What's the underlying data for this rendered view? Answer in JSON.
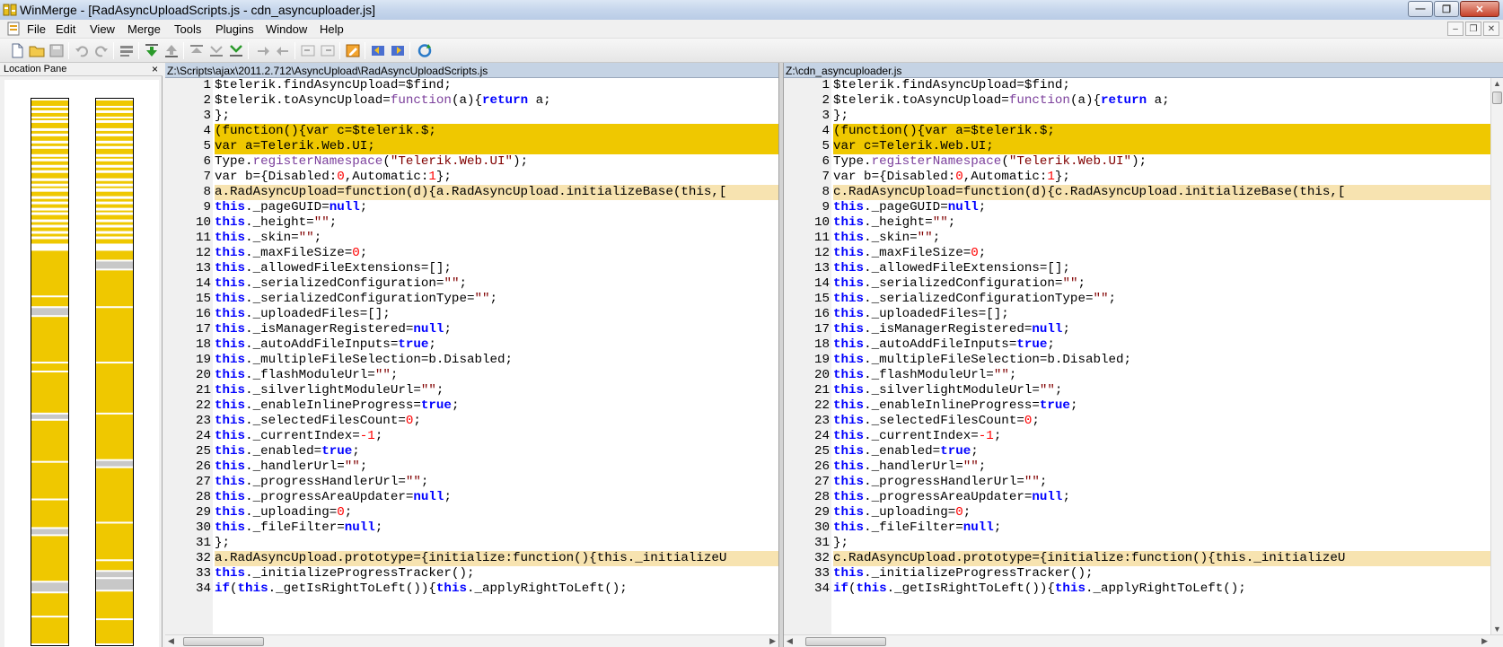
{
  "window": {
    "title": "WinMerge - [RadAsyncUploadScripts.js - cdn_asyncuploader.js]",
    "minimize_glyph": "—",
    "maximize_glyph": "❐",
    "close_glyph": "✕"
  },
  "menu": [
    "File",
    "Edit",
    "View",
    "Merge",
    "Tools",
    "Plugins",
    "Window",
    "Help"
  ],
  "mdi": {
    "minimize_glyph": "–",
    "restore_glyph": "❐",
    "close_glyph": "✕"
  },
  "location_pane": {
    "title": "Location Pane",
    "close_glyph": "×"
  },
  "left_pane": {
    "path": "Z:\\Scripts\\ajax\\2011.2.712\\AsyncUpload\\RadAsyncUploadScripts.js"
  },
  "right_pane": {
    "path": "Z:\\cdn_asyncuploader.js"
  },
  "colors": {
    "diff": "#efc800",
    "change": "#f7e3b0",
    "keyword": "#0000ff",
    "string": "#800000",
    "number": "#ff0000"
  },
  "left_lines": [
    {
      "n": "1",
      "t": "plain",
      "segs": [
        [
          "i",
          "$telerik.findAsyncUpload=$find;"
        ]
      ]
    },
    {
      "n": "2",
      "t": "plain",
      "segs": [
        [
          "i",
          "$telerik.toAsyncUpload="
        ],
        [
          "f",
          "function"
        ],
        [
          "i",
          "(a){"
        ],
        [
          "k",
          "return"
        ],
        [
          "i",
          " a;"
        ]
      ]
    },
    {
      "n": "3",
      "t": "plain",
      "segs": [
        [
          "i",
          "};"
        ]
      ]
    },
    {
      "n": "4",
      "t": "diff",
      "segs": [
        [
          "i",
          "(function(){var c=$telerik.$;"
        ]
      ]
    },
    {
      "n": "5",
      "t": "diff",
      "segs": [
        [
          "i",
          "var a=Telerik.Web.UI;"
        ]
      ]
    },
    {
      "n": "6",
      "t": "plain",
      "segs": [
        [
          "i",
          "Type."
        ],
        [
          "f",
          "registerNamespace"
        ],
        [
          "i",
          "("
        ],
        [
          "s",
          "\"Telerik.Web.UI\""
        ],
        [
          "i",
          ");"
        ]
      ]
    },
    {
      "n": "7",
      "t": "plain",
      "segs": [
        [
          "i",
          "var b={Disabled:"
        ],
        [
          "n",
          "0"
        ],
        [
          "i",
          ",Automatic:"
        ],
        [
          "n",
          "1"
        ],
        [
          "i",
          "};"
        ]
      ]
    },
    {
      "n": "8",
      "t": "change",
      "segs": [
        [
          "i",
          "a.RadAsyncUpload=function(d){a.RadAsyncUpload.initializeBase(this,["
        ]
      ]
    },
    {
      "n": "9",
      "t": "plain",
      "segs": [
        [
          "k",
          "this"
        ],
        [
          "i",
          "._pageGUID="
        ],
        [
          "k",
          "null"
        ],
        [
          "i",
          ";"
        ]
      ]
    },
    {
      "n": "10",
      "t": "plain",
      "segs": [
        [
          "k",
          "this"
        ],
        [
          "i",
          "._height="
        ],
        [
          "s",
          "\"\""
        ],
        [
          "i",
          ";"
        ]
      ]
    },
    {
      "n": "11",
      "t": "plain",
      "segs": [
        [
          "k",
          "this"
        ],
        [
          "i",
          "._skin="
        ],
        [
          "s",
          "\"\""
        ],
        [
          "i",
          ";"
        ]
      ]
    },
    {
      "n": "12",
      "t": "plain",
      "segs": [
        [
          "k",
          "this"
        ],
        [
          "i",
          "._maxFileSize="
        ],
        [
          "n",
          "0"
        ],
        [
          "i",
          ";"
        ]
      ]
    },
    {
      "n": "13",
      "t": "plain",
      "segs": [
        [
          "k",
          "this"
        ],
        [
          "i",
          "._allowedFileExtensions=[];"
        ]
      ]
    },
    {
      "n": "14",
      "t": "plain",
      "segs": [
        [
          "k",
          "this"
        ],
        [
          "i",
          "._serializedConfiguration="
        ],
        [
          "s",
          "\"\""
        ],
        [
          "i",
          ";"
        ]
      ]
    },
    {
      "n": "15",
      "t": "plain",
      "segs": [
        [
          "k",
          "this"
        ],
        [
          "i",
          "._serializedConfigurationType="
        ],
        [
          "s",
          "\"\""
        ],
        [
          "i",
          ";"
        ]
      ]
    },
    {
      "n": "16",
      "t": "plain",
      "segs": [
        [
          "k",
          "this"
        ],
        [
          "i",
          "._uploadedFiles=[];"
        ]
      ]
    },
    {
      "n": "17",
      "t": "plain",
      "segs": [
        [
          "k",
          "this"
        ],
        [
          "i",
          "._isManagerRegistered="
        ],
        [
          "k",
          "null"
        ],
        [
          "i",
          ";"
        ]
      ]
    },
    {
      "n": "18",
      "t": "plain",
      "segs": [
        [
          "k",
          "this"
        ],
        [
          "i",
          "._autoAddFileInputs="
        ],
        [
          "k",
          "true"
        ],
        [
          "i",
          ";"
        ]
      ]
    },
    {
      "n": "19",
      "t": "plain",
      "segs": [
        [
          "k",
          "this"
        ],
        [
          "i",
          "._multipleFileSelection=b.Disabled;"
        ]
      ]
    },
    {
      "n": "20",
      "t": "plain",
      "segs": [
        [
          "k",
          "this"
        ],
        [
          "i",
          "._flashModuleUrl="
        ],
        [
          "s",
          "\"\""
        ],
        [
          "i",
          ";"
        ]
      ]
    },
    {
      "n": "21",
      "t": "plain",
      "segs": [
        [
          "k",
          "this"
        ],
        [
          "i",
          "._silverlightModuleUrl="
        ],
        [
          "s",
          "\"\""
        ],
        [
          "i",
          ";"
        ]
      ]
    },
    {
      "n": "22",
      "t": "plain",
      "segs": [
        [
          "k",
          "this"
        ],
        [
          "i",
          "._enableInlineProgress="
        ],
        [
          "k",
          "true"
        ],
        [
          "i",
          ";"
        ]
      ]
    },
    {
      "n": "23",
      "t": "plain",
      "segs": [
        [
          "k",
          "this"
        ],
        [
          "i",
          "._selectedFilesCount="
        ],
        [
          "n",
          "0"
        ],
        [
          "i",
          ";"
        ]
      ]
    },
    {
      "n": "24",
      "t": "plain",
      "segs": [
        [
          "k",
          "this"
        ],
        [
          "i",
          "._currentIndex="
        ],
        [
          "n",
          "-1"
        ],
        [
          "i",
          ";"
        ]
      ]
    },
    {
      "n": "25",
      "t": "plain",
      "segs": [
        [
          "k",
          "this"
        ],
        [
          "i",
          "._enabled="
        ],
        [
          "k",
          "true"
        ],
        [
          "i",
          ";"
        ]
      ]
    },
    {
      "n": "26",
      "t": "plain",
      "segs": [
        [
          "k",
          "this"
        ],
        [
          "i",
          "._handlerUrl="
        ],
        [
          "s",
          "\"\""
        ],
        [
          "i",
          ";"
        ]
      ]
    },
    {
      "n": "27",
      "t": "plain",
      "segs": [
        [
          "k",
          "this"
        ],
        [
          "i",
          "._progressHandlerUrl="
        ],
        [
          "s",
          "\"\""
        ],
        [
          "i",
          ";"
        ]
      ]
    },
    {
      "n": "28",
      "t": "plain",
      "segs": [
        [
          "k",
          "this"
        ],
        [
          "i",
          "._progressAreaUpdater="
        ],
        [
          "k",
          "null"
        ],
        [
          "i",
          ";"
        ]
      ]
    },
    {
      "n": "29",
      "t": "plain",
      "segs": [
        [
          "k",
          "this"
        ],
        [
          "i",
          "._uploading="
        ],
        [
          "n",
          "0"
        ],
        [
          "i",
          ";"
        ]
      ]
    },
    {
      "n": "30",
      "t": "plain",
      "segs": [
        [
          "k",
          "this"
        ],
        [
          "i",
          "._fileFilter="
        ],
        [
          "k",
          "null"
        ],
        [
          "i",
          ";"
        ]
      ]
    },
    {
      "n": "31",
      "t": "plain",
      "segs": [
        [
          "i",
          "};"
        ]
      ]
    },
    {
      "n": "32",
      "t": "change",
      "segs": [
        [
          "i",
          "a.RadAsyncUpload.prototype={initialize:function(){this._initializeU"
        ]
      ]
    },
    {
      "n": "33",
      "t": "plain",
      "segs": [
        [
          "k",
          "this"
        ],
        [
          "i",
          "._initializeProgressTracker();"
        ]
      ]
    },
    {
      "n": "34",
      "t": "plain",
      "segs": [
        [
          "k",
          "if"
        ],
        [
          "i",
          "("
        ],
        [
          "k",
          "this"
        ],
        [
          "i",
          "._getIsRightToLeft()){"
        ],
        [
          "k",
          "this"
        ],
        [
          "i",
          "._applyRightToLeft();"
        ]
      ]
    }
  ],
  "right_lines": [
    {
      "n": "1",
      "t": "plain",
      "segs": [
        [
          "i",
          "$telerik.findAsyncUpload=$find;"
        ]
      ]
    },
    {
      "n": "2",
      "t": "plain",
      "segs": [
        [
          "i",
          "$telerik.toAsyncUpload="
        ],
        [
          "f",
          "function"
        ],
        [
          "i",
          "(a){"
        ],
        [
          "k",
          "return"
        ],
        [
          "i",
          " a;"
        ]
      ]
    },
    {
      "n": "3",
      "t": "plain",
      "segs": [
        [
          "i",
          "};"
        ]
      ]
    },
    {
      "n": "4",
      "t": "diff",
      "segs": [
        [
          "i",
          "(function(){var a=$telerik.$;"
        ]
      ]
    },
    {
      "n": "5",
      "t": "diff",
      "segs": [
        [
          "i",
          "var c=Telerik.Web.UI;"
        ]
      ]
    },
    {
      "n": "6",
      "t": "plain",
      "segs": [
        [
          "i",
          "Type."
        ],
        [
          "f",
          "registerNamespace"
        ],
        [
          "i",
          "("
        ],
        [
          "s",
          "\"Telerik.Web.UI\""
        ],
        [
          "i",
          ");"
        ]
      ]
    },
    {
      "n": "7",
      "t": "plain",
      "segs": [
        [
          "i",
          "var b={Disabled:"
        ],
        [
          "n",
          "0"
        ],
        [
          "i",
          ",Automatic:"
        ],
        [
          "n",
          "1"
        ],
        [
          "i",
          "};"
        ]
      ]
    },
    {
      "n": "8",
      "t": "change",
      "segs": [
        [
          "i",
          "c.RadAsyncUpload=function(d){c.RadAsyncUpload.initializeBase(this,["
        ]
      ]
    },
    {
      "n": "9",
      "t": "plain",
      "segs": [
        [
          "k",
          "this"
        ],
        [
          "i",
          "._pageGUID="
        ],
        [
          "k",
          "null"
        ],
        [
          "i",
          ";"
        ]
      ]
    },
    {
      "n": "10",
      "t": "plain",
      "segs": [
        [
          "k",
          "this"
        ],
        [
          "i",
          "._height="
        ],
        [
          "s",
          "\"\""
        ],
        [
          "i",
          ";"
        ]
      ]
    },
    {
      "n": "11",
      "t": "plain",
      "segs": [
        [
          "k",
          "this"
        ],
        [
          "i",
          "._skin="
        ],
        [
          "s",
          "\"\""
        ],
        [
          "i",
          ";"
        ]
      ]
    },
    {
      "n": "12",
      "t": "plain",
      "segs": [
        [
          "k",
          "this"
        ],
        [
          "i",
          "._maxFileSize="
        ],
        [
          "n",
          "0"
        ],
        [
          "i",
          ";"
        ]
      ]
    },
    {
      "n": "13",
      "t": "plain",
      "segs": [
        [
          "k",
          "this"
        ],
        [
          "i",
          "._allowedFileExtensions=[];"
        ]
      ]
    },
    {
      "n": "14",
      "t": "plain",
      "segs": [
        [
          "k",
          "this"
        ],
        [
          "i",
          "._serializedConfiguration="
        ],
        [
          "s",
          "\"\""
        ],
        [
          "i",
          ";"
        ]
      ]
    },
    {
      "n": "15",
      "t": "plain",
      "segs": [
        [
          "k",
          "this"
        ],
        [
          "i",
          "._serializedConfigurationType="
        ],
        [
          "s",
          "\"\""
        ],
        [
          "i",
          ";"
        ]
      ]
    },
    {
      "n": "16",
      "t": "plain",
      "segs": [
        [
          "k",
          "this"
        ],
        [
          "i",
          "._uploadedFiles=[];"
        ]
      ]
    },
    {
      "n": "17",
      "t": "plain",
      "segs": [
        [
          "k",
          "this"
        ],
        [
          "i",
          "._isManagerRegistered="
        ],
        [
          "k",
          "null"
        ],
        [
          "i",
          ";"
        ]
      ]
    },
    {
      "n": "18",
      "t": "plain",
      "segs": [
        [
          "k",
          "this"
        ],
        [
          "i",
          "._autoAddFileInputs="
        ],
        [
          "k",
          "true"
        ],
        [
          "i",
          ";"
        ]
      ]
    },
    {
      "n": "19",
      "t": "plain",
      "segs": [
        [
          "k",
          "this"
        ],
        [
          "i",
          "._multipleFileSelection=b.Disabled;"
        ]
      ]
    },
    {
      "n": "20",
      "t": "plain",
      "segs": [
        [
          "k",
          "this"
        ],
        [
          "i",
          "._flashModuleUrl="
        ],
        [
          "s",
          "\"\""
        ],
        [
          "i",
          ";"
        ]
      ]
    },
    {
      "n": "21",
      "t": "plain",
      "segs": [
        [
          "k",
          "this"
        ],
        [
          "i",
          "._silverlightModuleUrl="
        ],
        [
          "s",
          "\"\""
        ],
        [
          "i",
          ";"
        ]
      ]
    },
    {
      "n": "22",
      "t": "plain",
      "segs": [
        [
          "k",
          "this"
        ],
        [
          "i",
          "._enableInlineProgress="
        ],
        [
          "k",
          "true"
        ],
        [
          "i",
          ";"
        ]
      ]
    },
    {
      "n": "23",
      "t": "plain",
      "segs": [
        [
          "k",
          "this"
        ],
        [
          "i",
          "._selectedFilesCount="
        ],
        [
          "n",
          "0"
        ],
        [
          "i",
          ";"
        ]
      ]
    },
    {
      "n": "24",
      "t": "plain",
      "segs": [
        [
          "k",
          "this"
        ],
        [
          "i",
          "._currentIndex="
        ],
        [
          "n",
          "-1"
        ],
        [
          "i",
          ";"
        ]
      ]
    },
    {
      "n": "25",
      "t": "plain",
      "segs": [
        [
          "k",
          "this"
        ],
        [
          "i",
          "._enabled="
        ],
        [
          "k",
          "true"
        ],
        [
          "i",
          ";"
        ]
      ]
    },
    {
      "n": "26",
      "t": "plain",
      "segs": [
        [
          "k",
          "this"
        ],
        [
          "i",
          "._handlerUrl="
        ],
        [
          "s",
          "\"\""
        ],
        [
          "i",
          ";"
        ]
      ]
    },
    {
      "n": "27",
      "t": "plain",
      "segs": [
        [
          "k",
          "this"
        ],
        [
          "i",
          "._progressHandlerUrl="
        ],
        [
          "s",
          "\"\""
        ],
        [
          "i",
          ";"
        ]
      ]
    },
    {
      "n": "28",
      "t": "plain",
      "segs": [
        [
          "k",
          "this"
        ],
        [
          "i",
          "._progressAreaUpdater="
        ],
        [
          "k",
          "null"
        ],
        [
          "i",
          ";"
        ]
      ]
    },
    {
      "n": "29",
      "t": "plain",
      "segs": [
        [
          "k",
          "this"
        ],
        [
          "i",
          "._uploading="
        ],
        [
          "n",
          "0"
        ],
        [
          "i",
          ";"
        ]
      ]
    },
    {
      "n": "30",
      "t": "plain",
      "segs": [
        [
          "k",
          "this"
        ],
        [
          "i",
          "._fileFilter="
        ],
        [
          "k",
          "null"
        ],
        [
          "i",
          ";"
        ]
      ]
    },
    {
      "n": "31",
      "t": "plain",
      "segs": [
        [
          "i",
          "};"
        ]
      ]
    },
    {
      "n": "32",
      "t": "change",
      "segs": [
        [
          "i",
          "c.RadAsyncUpload.prototype={initialize:function(){this._initializeU"
        ]
      ]
    },
    {
      "n": "33",
      "t": "plain",
      "segs": [
        [
          "k",
          "this"
        ],
        [
          "i",
          "._initializeProgressTracker();"
        ]
      ]
    },
    {
      "n": "34",
      "t": "plain",
      "segs": [
        [
          "k",
          "if"
        ],
        [
          "i",
          "("
        ],
        [
          "k",
          "this"
        ],
        [
          "i",
          "._getIsRightToLeft()){"
        ],
        [
          "k",
          "this"
        ],
        [
          "i",
          "._applyRightToLeft();"
        ]
      ]
    }
  ]
}
